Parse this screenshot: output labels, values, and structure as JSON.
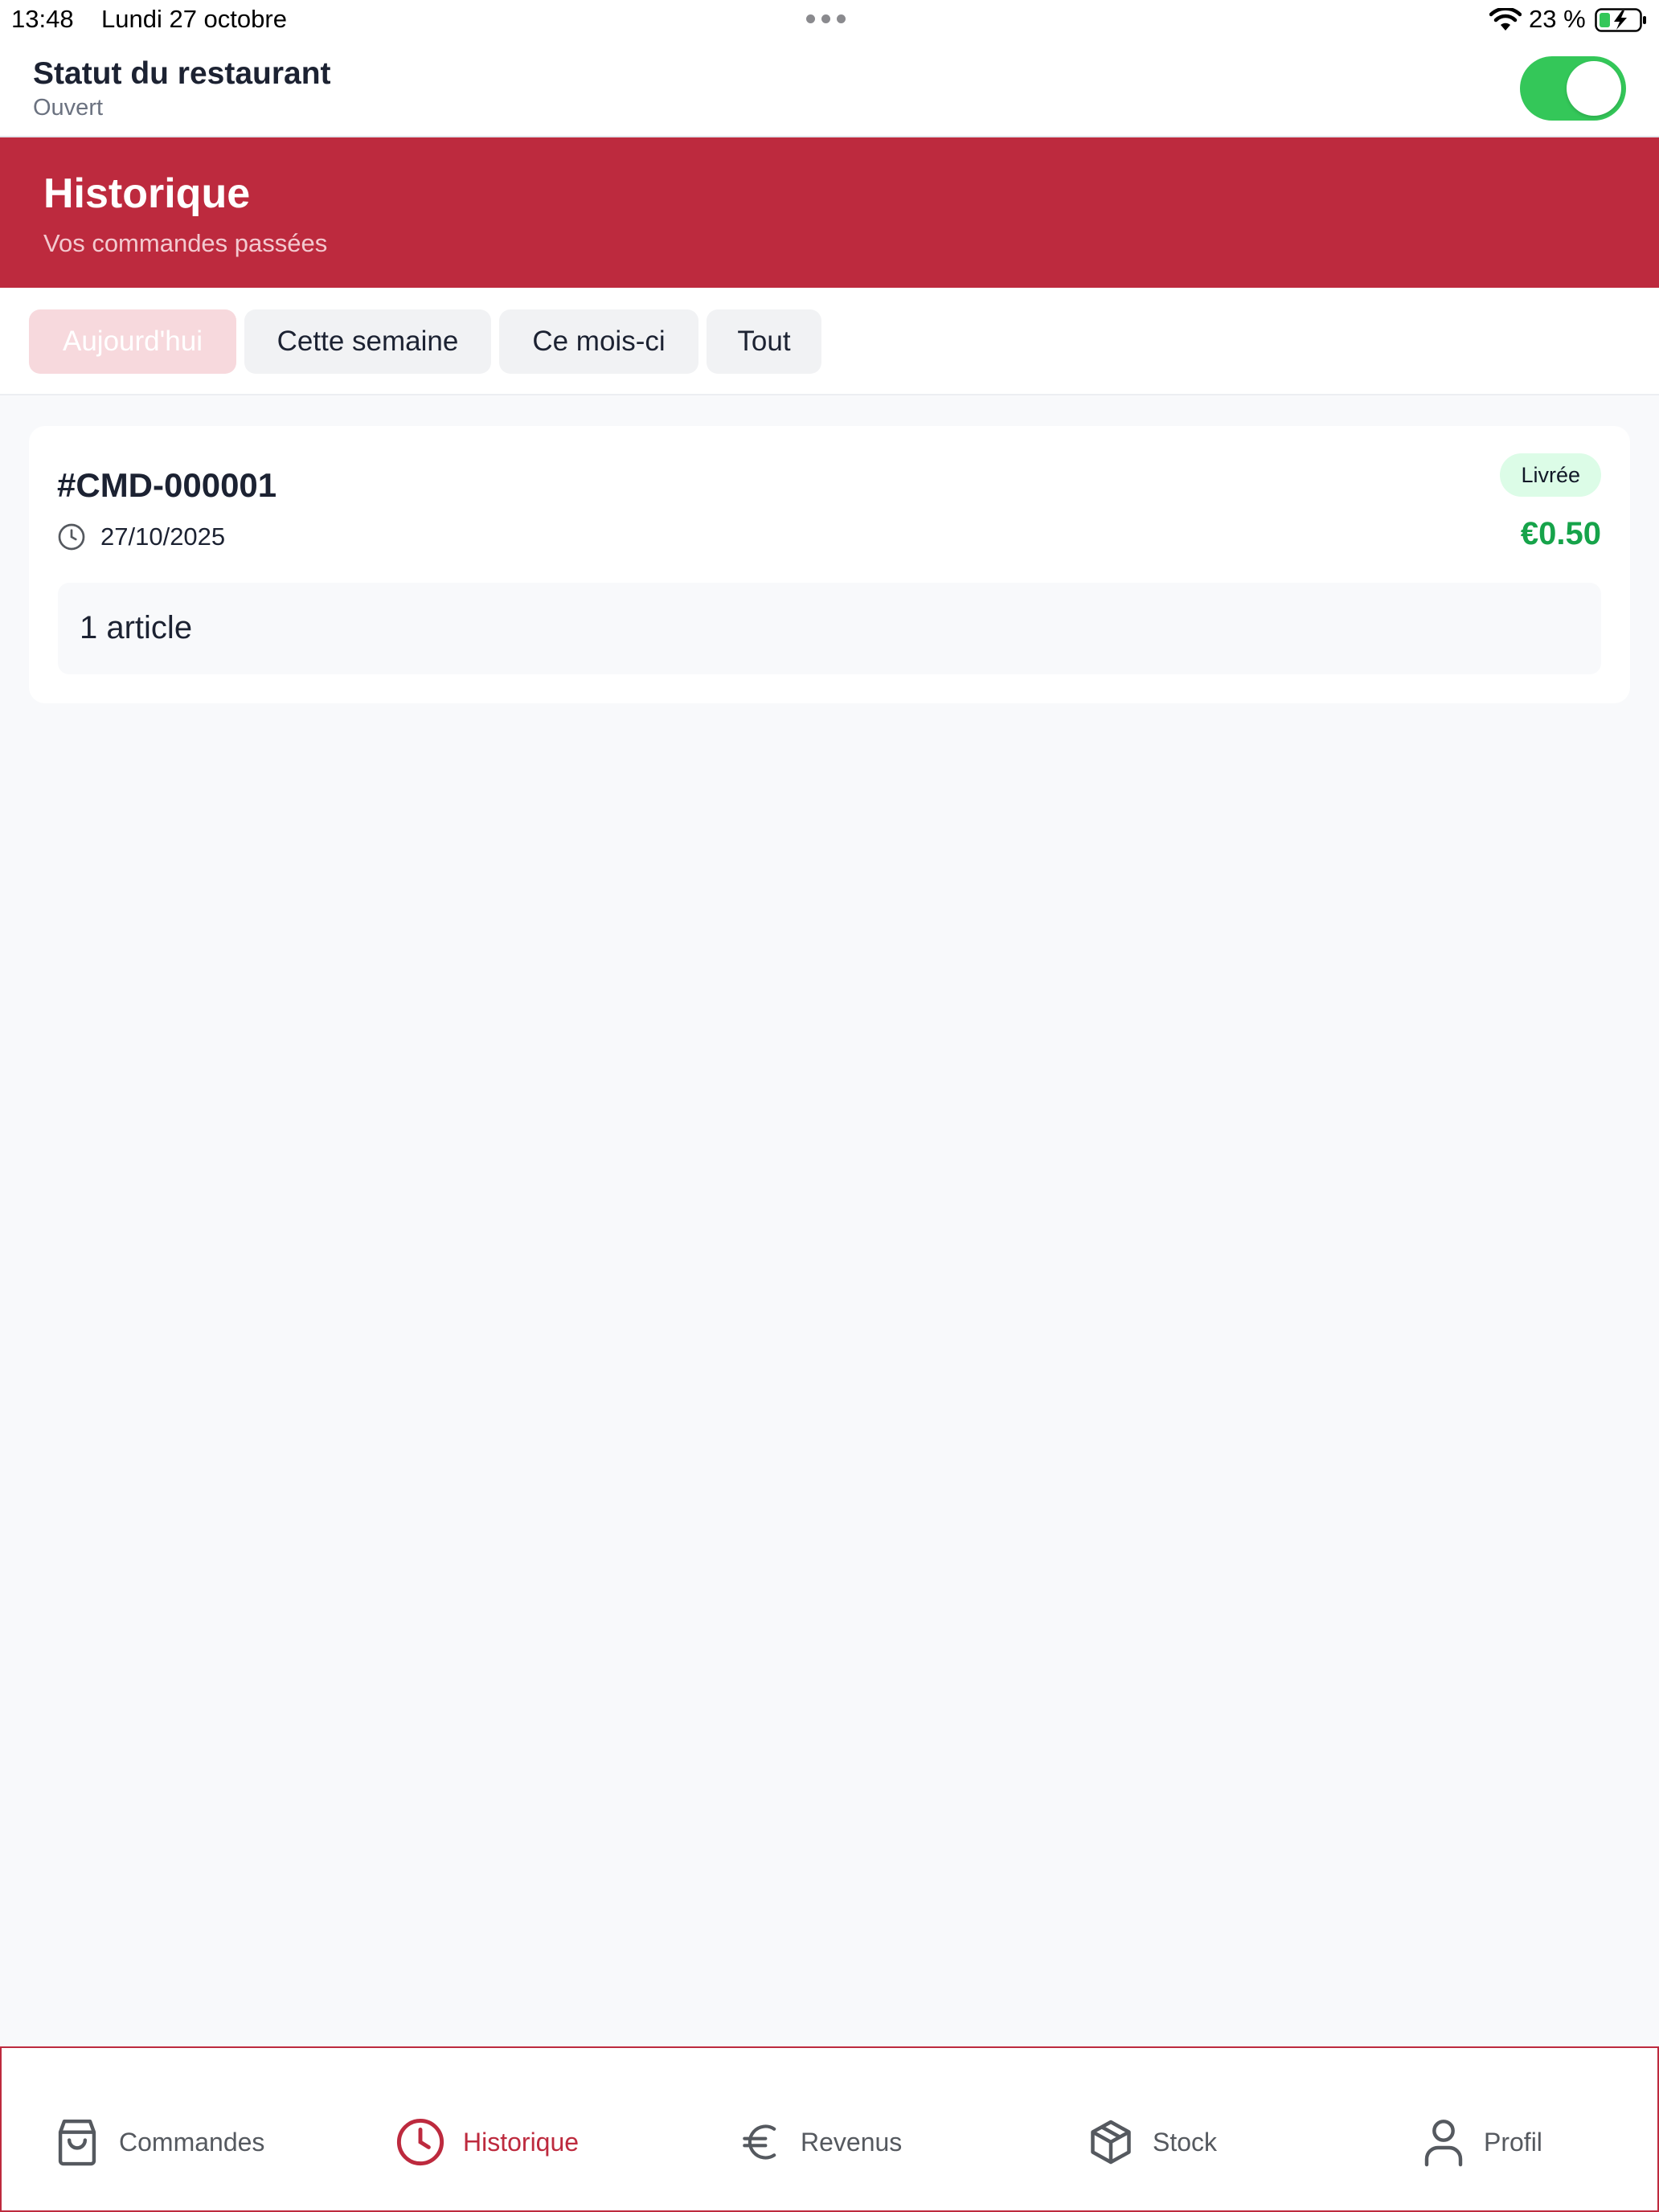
{
  "status_bar": {
    "time": "13:48",
    "date": "Lundi 27 octobre",
    "battery": "23 %"
  },
  "restaurant_status": {
    "title": "Statut du restaurant",
    "state": "Ouvert",
    "toggle_on": true
  },
  "banner": {
    "title": "Historique",
    "subtitle": "Vos commandes passées"
  },
  "filters": [
    {
      "label": "Aujourd'hui",
      "active": true
    },
    {
      "label": "Cette semaine",
      "active": false
    },
    {
      "label": "Ce mois-ci",
      "active": false
    },
    {
      "label": "Tout",
      "active": false
    }
  ],
  "orders": [
    {
      "id": "#CMD-000001",
      "date": "27/10/2025",
      "status": "Livrée",
      "total": "€0.50",
      "items_summary": "1 article"
    }
  ],
  "nav": [
    {
      "label": "Commandes",
      "icon": "shopping-bag-icon",
      "active": false
    },
    {
      "label": "Historique",
      "icon": "clock-icon",
      "active": true
    },
    {
      "label": "Revenus",
      "icon": "euro-icon",
      "active": false
    },
    {
      "label": "Stock",
      "icon": "box-icon",
      "active": false
    },
    {
      "label": "Profil",
      "icon": "user-icon",
      "active": false
    }
  ],
  "colors": {
    "brand_red": "#bd2a3e",
    "toggle_green": "#34c759",
    "price_green": "#16a34a",
    "badge_bg": "#dcfce7",
    "active_chip_bg": "#f7d9dd"
  }
}
